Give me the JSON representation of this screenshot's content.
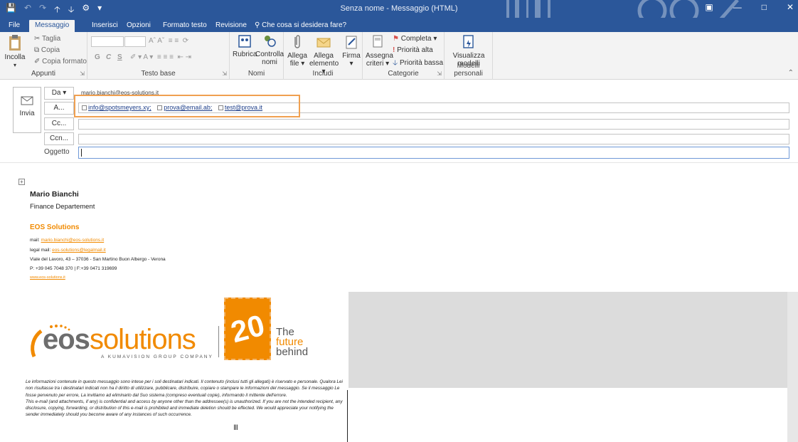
{
  "window": {
    "title": "Senza nome - Messaggio (HTML)"
  },
  "quick_access": {
    "icons": [
      "save-icon",
      "undo-icon",
      "redo-icon",
      "up-arrow-icon",
      "down-arrow-icon",
      "custom-icon",
      "dropdown-icon"
    ]
  },
  "tabs": [
    {
      "label": "File"
    },
    {
      "label": "Messaggio"
    },
    {
      "label": "Inserisci"
    },
    {
      "label": "Opzioni"
    },
    {
      "label": "Formato testo"
    },
    {
      "label": "Revisione"
    },
    {
      "label": "Che cosa si desidera fare?"
    }
  ],
  "ribbon": {
    "clipboard": {
      "paste": "Incolla",
      "cut": "Taglia",
      "copy": "Copia",
      "format_painter": "Copia formato",
      "group": "Appunti"
    },
    "basic_text": {
      "bold": "G",
      "italic": "C",
      "underline": "S",
      "group": "Testo base"
    },
    "names": {
      "address_book": "Rubrica",
      "check_names_line1": "Controlla",
      "check_names_line2": "nomi",
      "group": "Nomi"
    },
    "include": {
      "attach_file_line1": "Allega",
      "attach_file_line2": "file",
      "attach_item_line1": "Allega",
      "attach_item_line2": "elemento",
      "signature": "Firma",
      "group": "Includi"
    },
    "tags": {
      "assign_line1": "Assegna",
      "assign_line2": "criteri",
      "follow_up": "Completa",
      "high_priority": "Priorità alta",
      "low_priority": "Priorità bassa",
      "group": "Categorie"
    },
    "templates": {
      "view_line1": "Visualizza",
      "view_line2": "modelli",
      "group": "Modelli personali"
    }
  },
  "compose": {
    "send": "Invia",
    "from_btn": "Da ▾",
    "from_value": "mario.bianchi@eos-solutions.it",
    "to_btn": "A...",
    "recipients": [
      "info@spotsmeyers.xy;",
      "prova@email.ab;",
      "test@prova.it"
    ],
    "cc_btn": "Cc...",
    "bcc_btn": "Ccn...",
    "subject_label": "Oggetto",
    "subject_value": ""
  },
  "signature": {
    "name": "Mario Bianchi",
    "department": "Finance Departement",
    "company": "EOS Solutions",
    "mail_label": "mail:",
    "mail": "mario.bianchi@eos-solutions.it",
    "legal_label": "legal mail:",
    "legal_mail": "eos-solutions@legalmail.it",
    "address": "Viale del Lavoro, 43 – 37036 - San Martino Buon Albergo - Verona",
    "phone": "P: +39 045 7048 370 | F:+39 0471 319699",
    "website": "www.eos-solutions.it"
  },
  "logo": {
    "eos_part": "eos",
    "solutions_part": "solutions",
    "tagline": "A KUMAVISION GROUP COMPANY",
    "anniversary": "20",
    "slogan_line1": "The",
    "slogan_line2": "future",
    "slogan_line3": "behind"
  },
  "disclaimer": {
    "it": "Le informazioni contenute in questo messaggio sono intese per i soli destinatari indicati. Il contenuto (inclusi tutti gli allegati) è riservato e personale. Qualora Lei non risultasse tra i destinatari indicati non ha il diritto di utilizzare, pubblicare, distribuire, copiare o stampare le informazioni del messaggio. Se il messaggio Le fosse pervenuto per errore, La invitiamo ad eliminarlo dal Suo sistema (compreso eventuali copie), informando il mittente dell'errore.",
    "en": "This e-mail (and attachments, if any) is confidential and access by anyone other than the addressee(s) is unauthorized. If you are not the intended recipient, any disclosure, copying, forwarding, or distribution of this e-mail is prohibited and immediate deletion should be effected. We would appreciate your notifying the sender immediately should you become aware of any instances of such occurrence."
  },
  "colors": {
    "title_bar": "#2b579a",
    "accent_orange": "#f18a00",
    "highlight_border": "#f0a050",
    "link_blue": "#1e3f8a"
  }
}
